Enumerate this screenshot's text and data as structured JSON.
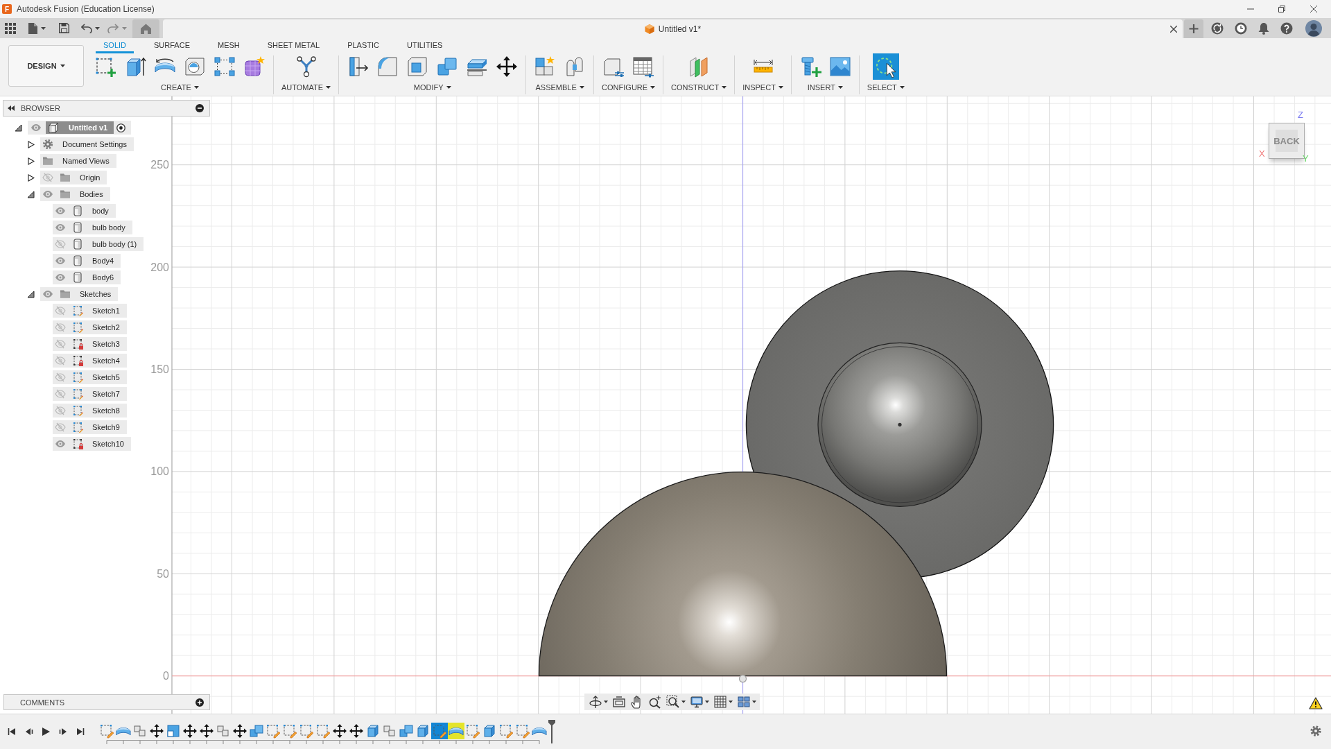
{
  "title_bar": {
    "logo": "F",
    "title": "Autodesk Fusion (Education License)"
  },
  "document_tab": {
    "title": "Untitled v1*"
  },
  "toolbar": {
    "workspace": "DESIGN",
    "tabs": [
      {
        "label": "SOLID",
        "selected": true
      },
      {
        "label": "SURFACE",
        "selected": false
      },
      {
        "label": "MESH",
        "selected": false
      },
      {
        "label": "SHEET METAL",
        "selected": false
      },
      {
        "label": "PLASTIC",
        "selected": false
      },
      {
        "label": "UTILITIES",
        "selected": false
      }
    ],
    "groups": [
      {
        "label": "CREATE",
        "tools": [
          {
            "kind": "sketch"
          },
          {
            "kind": "extrude"
          },
          {
            "kind": "revolve"
          },
          {
            "kind": "hole"
          },
          {
            "kind": "pattern"
          },
          {
            "kind": "form"
          }
        ]
      },
      {
        "label": "AUTOMATE",
        "tools": [
          {
            "kind": "automate"
          }
        ]
      },
      {
        "label": "MODIFY",
        "tools": [
          {
            "kind": "press"
          },
          {
            "kind": "fillet"
          },
          {
            "kind": "shell"
          },
          {
            "kind": "combine"
          },
          {
            "kind": "split"
          },
          {
            "kind": "move"
          }
        ]
      },
      {
        "label": "ASSEMBLE",
        "tools": [
          {
            "kind": "component"
          },
          {
            "kind": "joint"
          }
        ]
      },
      {
        "label": "CONFIGURE",
        "tools": [
          {
            "kind": "configure"
          },
          {
            "kind": "table"
          }
        ]
      },
      {
        "label": "CONSTRUCT",
        "tools": [
          {
            "kind": "plane"
          }
        ]
      },
      {
        "label": "INSPECT",
        "tools": [
          {
            "kind": "measure"
          }
        ]
      },
      {
        "label": "INSERT",
        "tools": [
          {
            "kind": "bolt"
          },
          {
            "kind": "image"
          }
        ]
      },
      {
        "label": "SELECT",
        "tools": [
          {
            "kind": "select"
          }
        ]
      }
    ]
  },
  "browser": {
    "title": "BROWSER",
    "tree": [
      {
        "label": "Untitled v1",
        "kind": "component",
        "expanded": true,
        "visible": true,
        "children": [
          {
            "label": "Document Settings",
            "kind": "settings",
            "expanded": false
          },
          {
            "label": "Named Views",
            "kind": "folder",
            "expanded": false
          },
          {
            "label": "Origin",
            "kind": "folder",
            "expanded": false,
            "visible": false
          },
          {
            "label": "Bodies",
            "kind": "folder",
            "expanded": true,
            "visible": true,
            "children": [
              {
                "label": "body",
                "kind": "body",
                "visible": true
              },
              {
                "label": "bulb body",
                "kind": "body",
                "visible": true
              },
              {
                "label": "bulb body (1)",
                "kind": "body",
                "visible": false
              },
              {
                "label": "Body4",
                "kind": "body",
                "visible": true
              },
              {
                "label": "Body6",
                "kind": "body",
                "visible": true
              }
            ]
          },
          {
            "label": "Sketches",
            "kind": "folder",
            "expanded": true,
            "visible": true,
            "children": [
              {
                "label": "Sketch1",
                "kind": "sketch",
                "visible": false,
                "locked": false
              },
              {
                "label": "Sketch2",
                "kind": "sketch",
                "visible": false,
                "locked": false
              },
              {
                "label": "Sketch3",
                "kind": "sketch",
                "visible": false,
                "locked": true
              },
              {
                "label": "Sketch4",
                "kind": "sketch",
                "visible": false,
                "locked": true
              },
              {
                "label": "Sketch5",
                "kind": "sketch",
                "visible": false,
                "locked": false
              },
              {
                "label": "Sketch7",
                "kind": "sketch",
                "visible": false,
                "locked": false
              },
              {
                "label": "Sketch8",
                "kind": "sketch",
                "visible": false,
                "locked": false
              },
              {
                "label": "Sketch9",
                "kind": "sketch",
                "visible": false,
                "locked": false
              },
              {
                "label": "Sketch10",
                "kind": "sketch",
                "visible": true,
                "locked": true
              }
            ]
          }
        ]
      }
    ]
  },
  "viewport": {
    "ruler_labels": [
      "250",
      "200",
      "150",
      "100",
      "50",
      "0"
    ],
    "view_cube": {
      "face": "BACK",
      "axes": [
        {
          "label": "Z",
          "color": "#7b7bf0"
        },
        {
          "label": "X",
          "color": "#f07a7a"
        },
        {
          "label": "Y",
          "color": "#6ad86a"
        }
      ]
    }
  },
  "comments": {
    "title": "COMMENTS"
  },
  "timeline": {
    "features": [
      {
        "kind": "sketch",
        "selected": false,
        "highlighted": false
      },
      {
        "kind": "revolve",
        "selected": false,
        "highlighted": false
      },
      {
        "kind": "joint",
        "selected": false,
        "highlighted": false
      },
      {
        "kind": "move",
        "selected": false,
        "highlighted": false
      },
      {
        "kind": "box",
        "selected": false,
        "highlighted": false
      },
      {
        "kind": "move",
        "selected": false,
        "highlighted": false
      },
      {
        "kind": "move",
        "selected": false,
        "highlighted": false
      },
      {
        "kind": "joint",
        "selected": false,
        "highlighted": false
      },
      {
        "kind": "move",
        "selected": false,
        "highlighted": false
      },
      {
        "kind": "combine",
        "selected": false,
        "highlighted": false
      },
      {
        "kind": "sketch",
        "selected": false,
        "highlighted": false
      },
      {
        "kind": "sketch",
        "selected": false,
        "highlighted": false
      },
      {
        "kind": "sketch",
        "selected": false,
        "highlighted": false
      },
      {
        "kind": "sketch",
        "selected": false,
        "highlighted": false
      },
      {
        "kind": "move",
        "selected": false,
        "highlighted": false
      },
      {
        "kind": "move",
        "selected": false,
        "highlighted": false
      },
      {
        "kind": "extrude",
        "selected": false,
        "highlighted": false
      },
      {
        "kind": "joint",
        "selected": false,
        "highlighted": false
      },
      {
        "kind": "combine",
        "selected": false,
        "highlighted": false
      },
      {
        "kind": "extrude",
        "selected": false,
        "highlighted": false
      },
      {
        "kind": "sketch",
        "selected": true,
        "highlighted": false
      },
      {
        "kind": "revolve",
        "selected": false,
        "highlighted": true
      },
      {
        "kind": "sketch",
        "selected": false,
        "highlighted": false
      },
      {
        "kind": "extrude",
        "selected": false,
        "highlighted": false
      },
      {
        "kind": "sketch",
        "selected": false,
        "highlighted": false
      },
      {
        "kind": "sketch",
        "selected": false,
        "highlighted": false
      },
      {
        "kind": "revolve",
        "selected": false,
        "highlighted": false
      }
    ]
  }
}
